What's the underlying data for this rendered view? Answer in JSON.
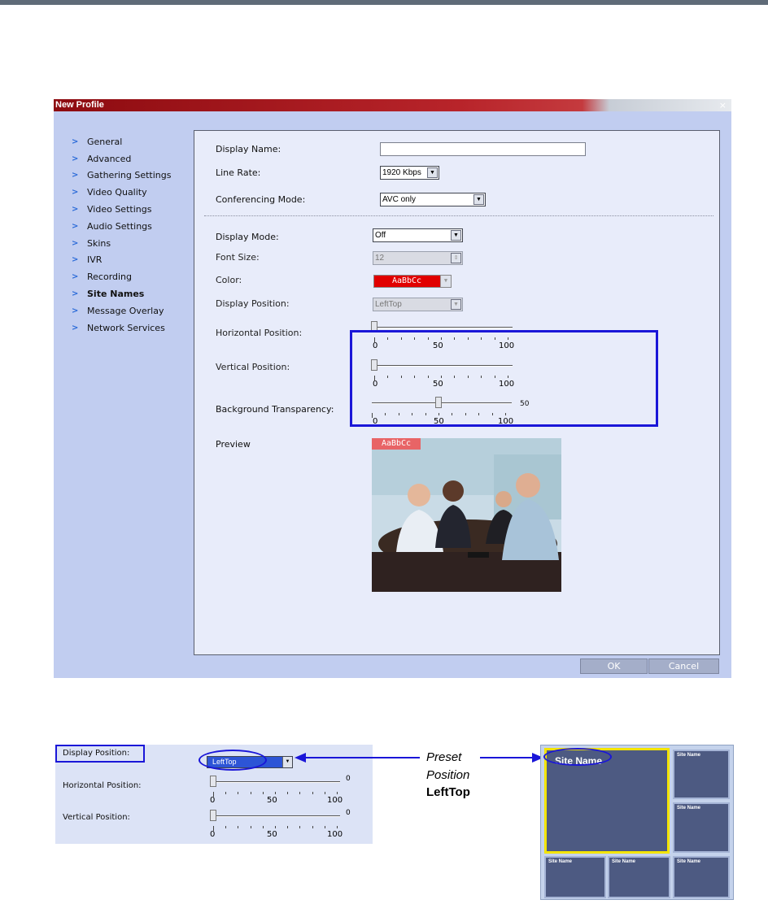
{
  "dialog": {
    "title": "New Profile",
    "close_glyph": "×",
    "nav": [
      {
        "label": "General"
      },
      {
        "label": "Advanced"
      },
      {
        "label": "Gathering Settings"
      },
      {
        "label": "Video Quality"
      },
      {
        "label": "Video Settings"
      },
      {
        "label": "Audio Settings"
      },
      {
        "label": "Skins"
      },
      {
        "label": "IVR"
      },
      {
        "label": "Recording"
      },
      {
        "label": "Site Names",
        "active": true
      },
      {
        "label": "Message Overlay"
      },
      {
        "label": "Network Services"
      }
    ],
    "form": {
      "display_name_label": "Display Name:",
      "display_name_value": "",
      "line_rate_label": "Line Rate:",
      "line_rate_value": "1920 Kbps",
      "conferencing_mode_label": "Conferencing Mode:",
      "conferencing_mode_value": "AVC only",
      "display_mode_label": "Display Mode:",
      "display_mode_value": "Off",
      "font_size_label": "Font Size:",
      "font_size_value": "12",
      "color_label": "Color:",
      "color_value": "AaBbCc",
      "display_position_label": "Display Position:",
      "display_position_value": "LeftTop",
      "horizontal_position_label": "Horizontal Position:",
      "horizontal_position_value": 0,
      "vertical_position_label": "Vertical Position:",
      "vertical_position_value": 0,
      "background_transparency_label": "Background Transparency:",
      "background_transparency_value": 50,
      "background_transparency_text": "50",
      "scale_min": "0",
      "scale_mid": "50",
      "scale_max": "100",
      "preview_label": "Preview",
      "preview_tag": "AaBbCc"
    },
    "buttons": {
      "ok": "OK",
      "cancel": "Cancel"
    }
  },
  "callout": {
    "display_position_label": "Display Position:",
    "display_position_value": "LeftTop",
    "horizontal_position_label": "Horizontal Position:",
    "vertical_position_label": "Vertical Position:",
    "horizontal_value_text": "0",
    "vertical_value_text": "0",
    "scale_min": "0",
    "scale_mid": "50",
    "scale_max": "100"
  },
  "annotation": {
    "line1": "Preset",
    "line2": "Position",
    "line3": "LeftTop"
  },
  "layout_preview": {
    "main_label": "Site Name",
    "cell_label": "Site Name"
  },
  "colors": {
    "title_bar": "#b8242a",
    "panel_background": "#e8ecfa",
    "dialog_background": "#c1cdf0",
    "highlight_border": "#1a16d8",
    "site_name_color": "#e10000",
    "layout_main_border": "#f3e400"
  }
}
